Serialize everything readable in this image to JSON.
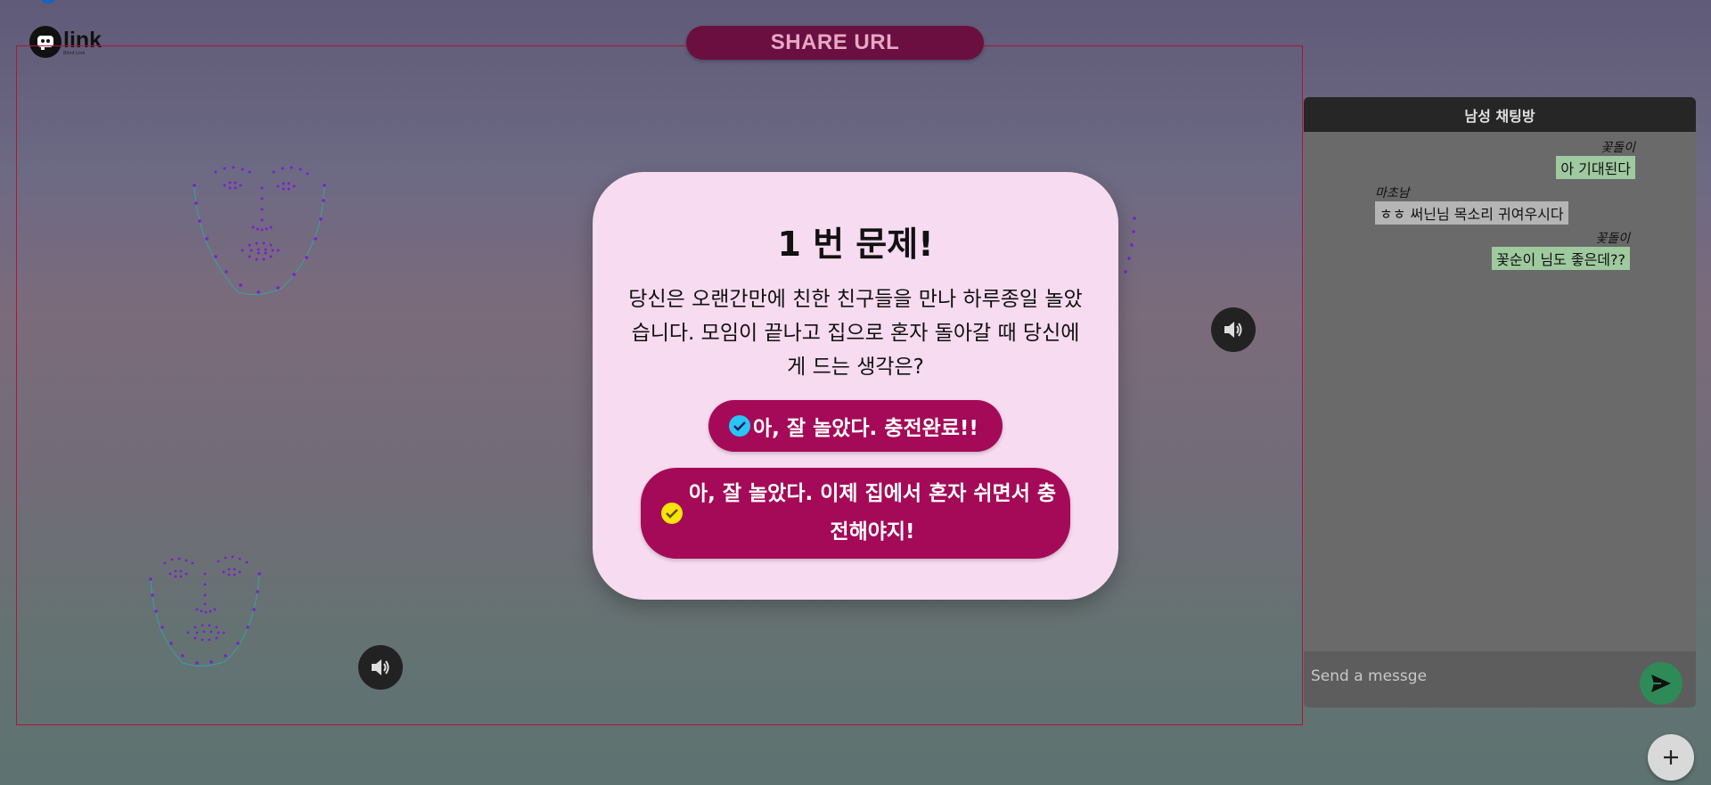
{
  "app": {
    "logo_text": "link",
    "logo_subtext": "Blind Link"
  },
  "share": {
    "label": "SHARE URL"
  },
  "question": {
    "title": "1 번 문제!",
    "body": "당신은 오랜간만에 친한 친구들을 만나 하루종일 놀았습니다. 모임이 끝나고 집으로 혼자 돌아갈 때 당신에게 드는 생각은?",
    "options": [
      {
        "label": "아, 잘 놀았다. 충전완료!!",
        "check_color": "#29c5f6"
      },
      {
        "label": "아, 잘 놀았다. 이제 집에서 혼자 쉬면서 충전해야지!",
        "check_color": "#f5e50a"
      }
    ]
  },
  "chat": {
    "title": "남성 채팅방",
    "messages": [
      {
        "sender": "꽃돌이",
        "text": "아 기대된다",
        "mine": true
      },
      {
        "sender": "마초남",
        "text": "ㅎㅎ 써닌님 목소리 귀여우시다",
        "mine": false
      },
      {
        "sender": "꽃돌이",
        "text": "꽃순이 님도 좋은데??",
        "mine": true
      }
    ],
    "input_placeholder": "Send a messge"
  },
  "icons": {
    "speaker": "volume-icon",
    "send": "send-icon",
    "add": "plus-icon",
    "check": "check-circle-icon"
  },
  "colors": {
    "accent": "#a40a57",
    "share_bg": "#6a0f3f",
    "modal_bg": "#f7dbf0",
    "send_bg": "#2e8b57"
  }
}
